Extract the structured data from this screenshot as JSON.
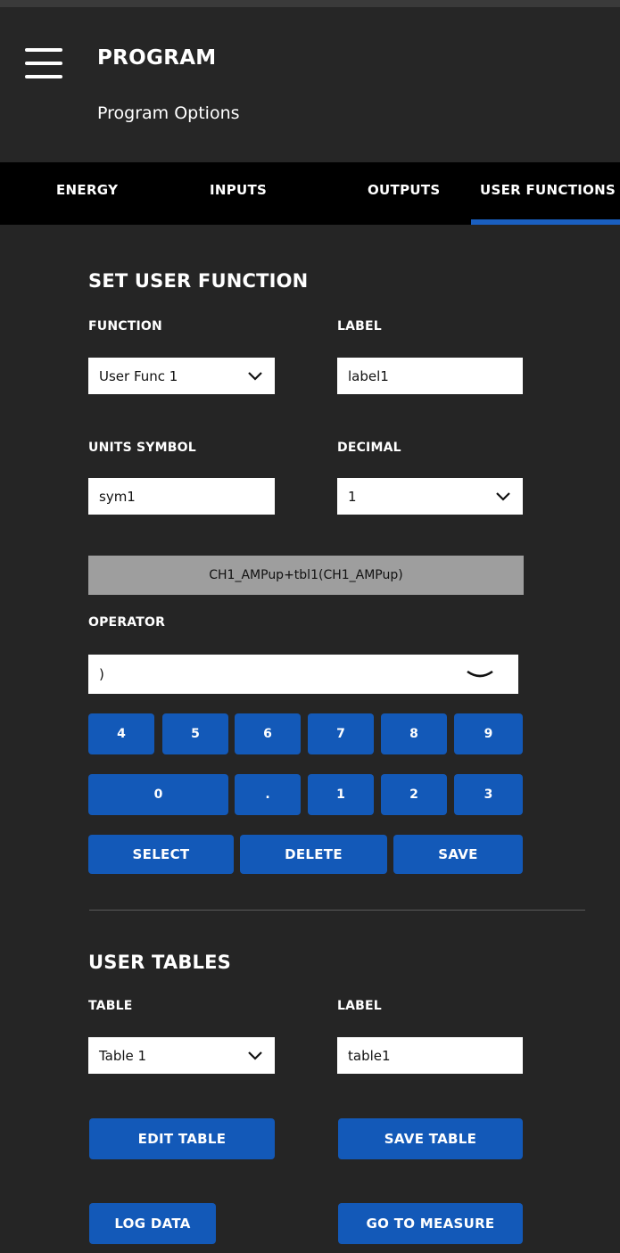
{
  "header": {
    "title": "PROGRAM",
    "subtitle": "Program Options"
  },
  "tabs": [
    {
      "label": "ENERGY"
    },
    {
      "label": "INPUTS"
    },
    {
      "label": "OUTPUTS"
    },
    {
      "label": "USER FUNCTIONS",
      "active": true
    }
  ],
  "user_function": {
    "section_title": "SET USER FUNCTION",
    "function_label": "FUNCTION",
    "function_value": "User Func 1",
    "label_label": "LABEL",
    "label_value": "label1",
    "units_label": "UNITS SYMBOL",
    "units_value": "sym1",
    "decimal_label": "DECIMAL",
    "decimal_value": "1",
    "formula": "CH1_AMPup+tbl1(CH1_AMPup)",
    "operator_label": "OPERATOR",
    "operator_value": ")"
  },
  "keypad": {
    "row1": [
      "4",
      "5",
      "6",
      "7",
      "8",
      "9"
    ],
    "row2": [
      "0",
      ".",
      "1",
      "2",
      "3"
    ]
  },
  "actions": {
    "select": "SELECT",
    "delete": "DELETE",
    "save": "SAVE"
  },
  "user_tables": {
    "section_title": "USER TABLES",
    "table_label": "TABLE",
    "table_value": "Table 1",
    "label_label": "LABEL",
    "label_value": "table1",
    "edit_table": "EDIT TABLE",
    "save_table": "SAVE TABLE"
  },
  "footer": {
    "log_data": "LOG DATA",
    "go_to_measure": "GO TO MEASURE"
  },
  "colors": {
    "background": "#252525",
    "tabbar": "#000000",
    "accent_blue": "#1359b8",
    "formula_bg": "#9e9e9e"
  }
}
